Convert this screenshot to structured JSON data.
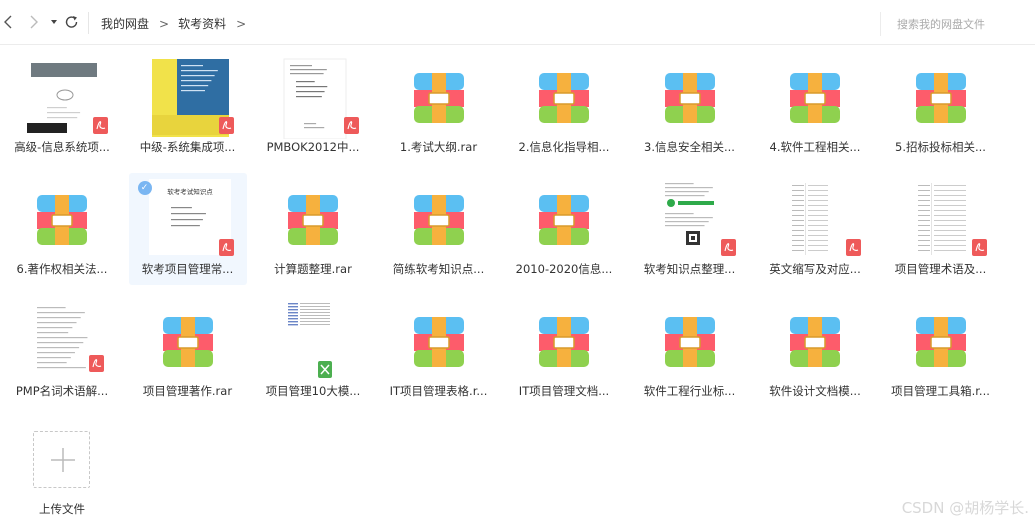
{
  "breadcrumb": {
    "root": "我的网盘",
    "current": "软考资料",
    "sep": ">"
  },
  "search": {
    "placeholder": "搜索我的网盘文件"
  },
  "files": [
    {
      "name": "高级-信息系统项...",
      "kind": "pdf-cover-gray"
    },
    {
      "name": "中级-系统集成项...",
      "kind": "pdf-cover-yellow"
    },
    {
      "name": "PMBOK2012中...",
      "kind": "pdf-cover-white"
    },
    {
      "name": "1.考试大纲.rar",
      "kind": "rar"
    },
    {
      "name": "2.信息化指导相...",
      "kind": "rar"
    },
    {
      "name": "3.信息安全相关...",
      "kind": "rar"
    },
    {
      "name": "4.软件工程相关...",
      "kind": "rar"
    },
    {
      "name": "5.招标投标相关...",
      "kind": "rar"
    },
    {
      "name": "6.著作权相关法...",
      "kind": "rar"
    },
    {
      "name": "软考项目管理常...",
      "kind": "pdf-doc-title",
      "selected": true,
      "doc_title": "软考考试知识点"
    },
    {
      "name": "计算题整理.rar",
      "kind": "rar"
    },
    {
      "name": "简练软考知识点...",
      "kind": "rar"
    },
    {
      "name": "2010-2020信息...",
      "kind": "rar"
    },
    {
      "name": "软考知识点整理...",
      "kind": "pdf-doc-qr"
    },
    {
      "name": "英文缩写及对应...",
      "kind": "pdf-doc-table"
    },
    {
      "name": "项目管理术语及...",
      "kind": "pdf-doc-table2"
    },
    {
      "name": "PMP名词术语解...",
      "kind": "pdf-doc-text"
    },
    {
      "name": "项目管理著作.rar",
      "kind": "rar"
    },
    {
      "name": "项目管理10大模...",
      "kind": "xls-doc"
    },
    {
      "name": "IT项目管理表格.r...",
      "kind": "rar"
    },
    {
      "name": "IT项目管理文档...",
      "kind": "rar"
    },
    {
      "name": "软件工程行业标...",
      "kind": "rar"
    },
    {
      "name": "软件设计文档模...",
      "kind": "rar"
    },
    {
      "name": "项目管理工具箱.r...",
      "kind": "rar"
    }
  ],
  "upload": {
    "label": "上传文件"
  },
  "watermark": "CSDN @胡杨学长.",
  "colors": {
    "rar_red": "#fd5c6b",
    "rar_blue": "#5bbff2",
    "rar_green": "#8fd14f",
    "rar_band": "#f6b13e",
    "pdf_badge": "#ee5a5a",
    "xls_badge": "#4caf50"
  }
}
